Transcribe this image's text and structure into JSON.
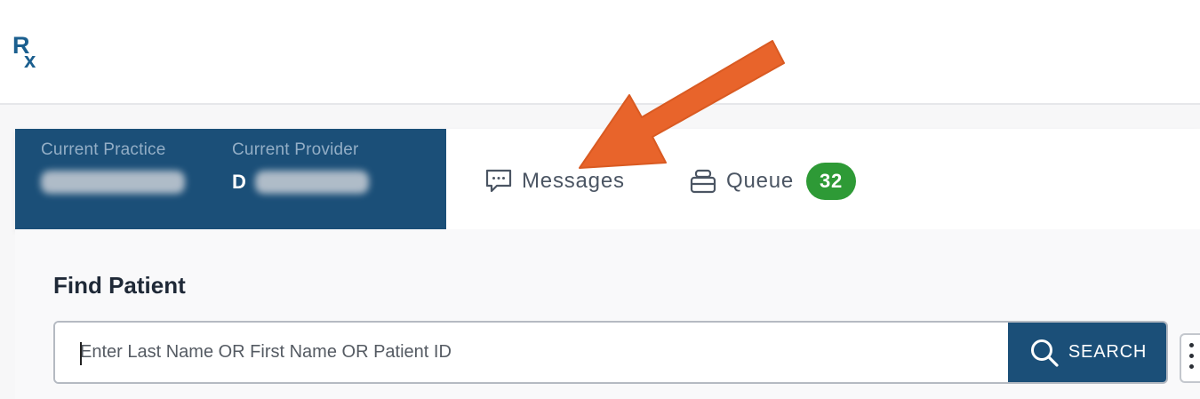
{
  "app": {
    "logo": "Rx"
  },
  "context": {
    "practice_label": "Current Practice",
    "provider_label": "Current Provider",
    "provider_initial": "D"
  },
  "nav": {
    "messages_label": "Messages",
    "messages_icon": "chat-bubble-icon",
    "queue_label": "Queue",
    "queue_icon": "stack-icon",
    "queue_count": "32"
  },
  "find_patient": {
    "title": "Find Patient",
    "placeholder": "Enter Last Name OR First Name OR Patient ID",
    "search_label": "SEARCH",
    "search_icon": "magnifier-icon",
    "more_icon": "kebab-icon"
  },
  "colors": {
    "brand": "#1b4f78",
    "badge": "#2e9a36",
    "annotation_arrow": "#e8642b"
  }
}
